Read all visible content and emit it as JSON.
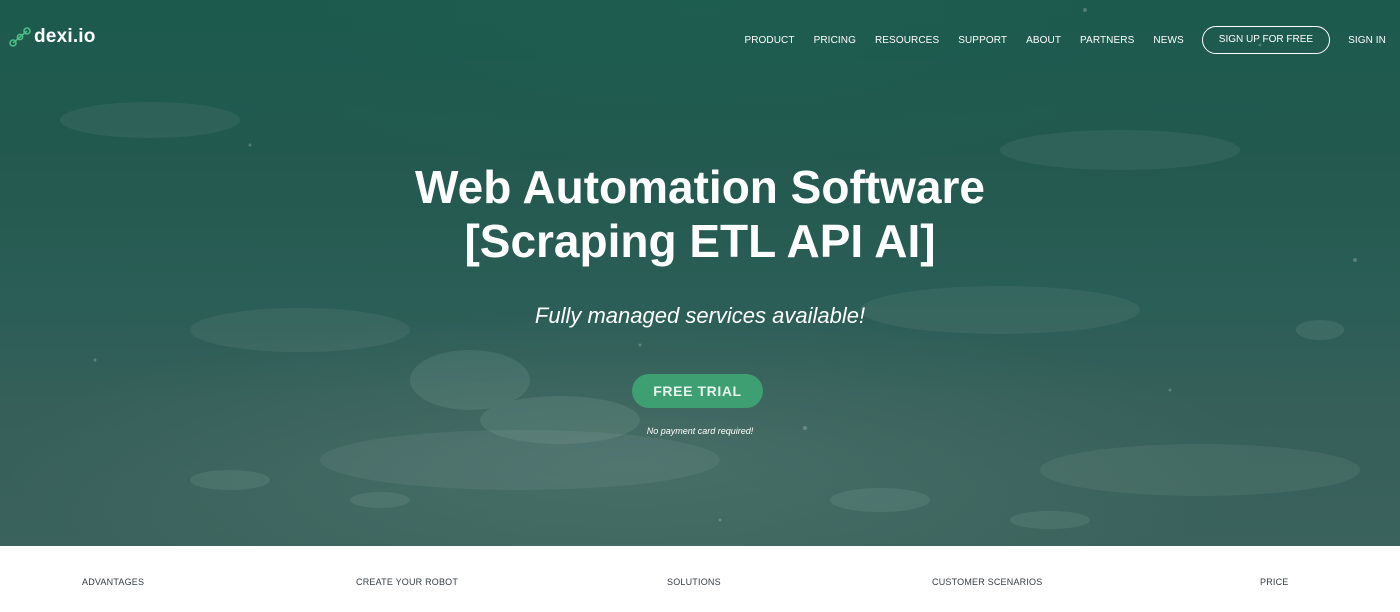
{
  "brand": {
    "name": "dexi.io",
    "icon": "node-link-icon",
    "accent_color": "#3e9f72"
  },
  "nav": {
    "items": [
      "PRODUCT",
      "PRICING",
      "RESOURCES",
      "SUPPORT",
      "ABOUT",
      "PARTNERS",
      "NEWS"
    ],
    "signup_label": "SIGN UP FOR FREE",
    "signin_label": "SIGN IN"
  },
  "hero": {
    "title_line1": "Web Automation Software",
    "title_line2": "[Scraping ETL API AI]",
    "subtitle": "Fully managed services available!",
    "cta_label": "FREE TRIAL",
    "cta_note": "No payment card required!",
    "background_color": "#23594f"
  },
  "subnav": {
    "items": [
      "ADVANTAGES",
      "CREATE YOUR ROBOT",
      "SOLUTIONS",
      "CUSTOMER SCENARIOS",
      "PRICE"
    ]
  }
}
